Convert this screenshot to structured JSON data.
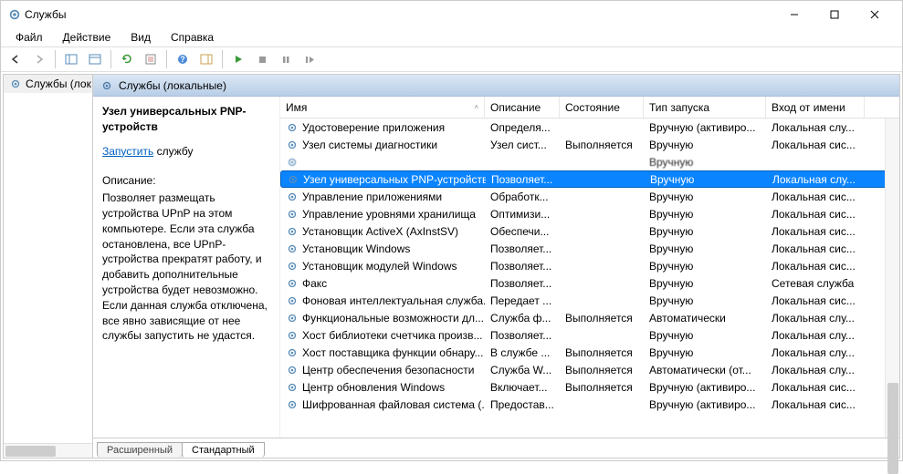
{
  "window": {
    "title": "Службы"
  },
  "menu": {
    "file": "Файл",
    "action": "Действие",
    "view": "Вид",
    "help": "Справка"
  },
  "tree": {
    "root": "Службы (лок"
  },
  "panel_header": "Службы (локальные)",
  "detail": {
    "title": "Узел универсальных PNP-устройств",
    "start_link": "Запустить",
    "start_suffix": " службу",
    "desc_label": "Описание:",
    "desc_body": "Позволяет размещать устройства UPnP на этом компьютере. Если эта служба остановлена, все UPnP-устройства прекратят работу, и добавить дополнительные устройства будет невозможно. Если данная служба отключена, все явно зависящие от нее службы запустить не удастся."
  },
  "columns": {
    "name": "Имя",
    "desc": "Описание",
    "state": "Состояние",
    "startup": "Тип запуска",
    "logon": "Вход от имени"
  },
  "rows": [
    {
      "name": "Удостоверение приложения",
      "desc": "Определя...",
      "state": "",
      "startup": "Вручную (активиро...",
      "logon": "Локальная слу..."
    },
    {
      "name": "Узел системы диагностики",
      "desc": "Узел сист...",
      "state": "Выполняется",
      "startup": "Вручную",
      "logon": "Локальная сис..."
    },
    {
      "name": "",
      "desc": "",
      "state": "",
      "startup": "Вручную",
      "logon": "",
      "blur": true
    },
    {
      "name": "Узел универсальных PNP-устройств",
      "desc": "Позволяет...",
      "state": "",
      "startup": "Вручную",
      "logon": "Локальная слу...",
      "selected": true
    },
    {
      "name": "Управление приложениями",
      "desc": "Обработк...",
      "state": "",
      "startup": "Вручную",
      "logon": "Локальная сис..."
    },
    {
      "name": "Управление уровнями хранилища",
      "desc": "Оптимизи...",
      "state": "",
      "startup": "Вручную",
      "logon": "Локальная сис..."
    },
    {
      "name": "Установщик ActiveX (AxInstSV)",
      "desc": "Обеспечи...",
      "state": "",
      "startup": "Вручную",
      "logon": "Локальная сис..."
    },
    {
      "name": "Установщик Windows",
      "desc": "Позволяет...",
      "state": "",
      "startup": "Вручную",
      "logon": "Локальная сис..."
    },
    {
      "name": "Установщик модулей Windows",
      "desc": "Позволяет...",
      "state": "",
      "startup": "Вручную",
      "logon": "Локальная сис..."
    },
    {
      "name": "Факс",
      "desc": "Позволяет...",
      "state": "",
      "startup": "Вручную",
      "logon": "Сетевая служба"
    },
    {
      "name": "Фоновая интеллектуальная служба...",
      "desc": "Передает ...",
      "state": "",
      "startup": "Вручную",
      "logon": "Локальная сис..."
    },
    {
      "name": "Функциональные возможности дл...",
      "desc": "Служба ф...",
      "state": "Выполняется",
      "startup": "Автоматически",
      "logon": "Локальная слу..."
    },
    {
      "name": "Хост библиотеки счетчика произв...",
      "desc": "Позволяет...",
      "state": "",
      "startup": "Вручную",
      "logon": "Локальная слу..."
    },
    {
      "name": "Хост поставщика функции обнару...",
      "desc": "В службе ...",
      "state": "Выполняется",
      "startup": "Вручную",
      "logon": "Локальная слу..."
    },
    {
      "name": "Центр обеспечения безопасности",
      "desc": "Служба W...",
      "state": "Выполняется",
      "startup": "Автоматически (от...",
      "logon": "Локальная слу..."
    },
    {
      "name": "Центр обновления Windows",
      "desc": "Включает...",
      "state": "Выполняется",
      "startup": "Вручную (активиро...",
      "logon": "Локальная сис..."
    },
    {
      "name": "Шифрованная файловая система (...",
      "desc": "Предостав...",
      "state": "",
      "startup": "Вручную (активиро...",
      "logon": "Локальная сис..."
    }
  ],
  "tabs": {
    "extended": "Расширенный",
    "standard": "Стандартный"
  }
}
